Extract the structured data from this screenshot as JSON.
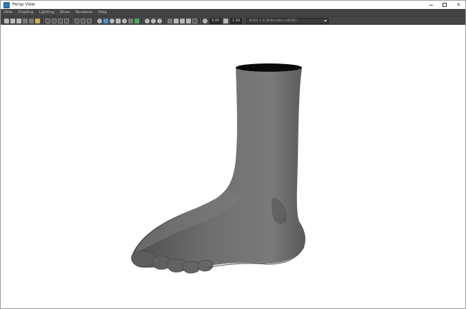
{
  "window": {
    "title": "Persp View",
    "controls": [
      "minimize",
      "maximize",
      "close"
    ],
    "close_glyph": "✕"
  },
  "menubar": {
    "items": [
      "View",
      "Shading",
      "Lighting",
      "Show",
      "Renderer",
      "Help"
    ]
  },
  "toolbar": {
    "exposure_value": "0.00",
    "gamma_value": "1.00",
    "color_space": "ACES 1.0 SDR-video (sRGB)"
  },
  "viewport": {
    "background_color": "#ffffff",
    "model_color": "#6b6b6b",
    "model_opening_color": "#0a0a0a"
  }
}
